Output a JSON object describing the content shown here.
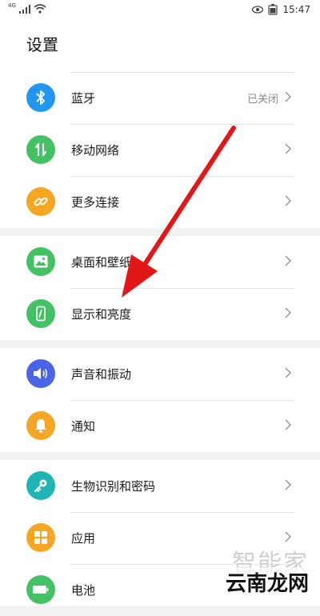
{
  "status_bar": {
    "network_label": "4G",
    "time": "15:47"
  },
  "page_title": "设置",
  "groups": [
    {
      "items": [
        {
          "label": "蓝牙",
          "value": "已关闭",
          "icon": "bluetooth-icon",
          "color": "#2196f3"
        },
        {
          "label": "移动网络",
          "icon": "mobile-data-icon",
          "color": "#43c163"
        },
        {
          "label": "更多连接",
          "icon": "link-icon",
          "color": "#f5a623"
        }
      ]
    },
    {
      "items": [
        {
          "label": "桌面和壁纸",
          "icon": "wallpaper-icon",
          "color": "#43c163"
        },
        {
          "label": "显示和亮度",
          "icon": "display-icon",
          "color": "#43c163"
        }
      ]
    },
    {
      "items": [
        {
          "label": "声音和振动",
          "icon": "sound-icon",
          "color": "#4a64e8"
        },
        {
          "label": "通知",
          "icon": "notification-bell-icon",
          "color": "#f5a623"
        }
      ]
    },
    {
      "items": [
        {
          "label": "生物识别和密码",
          "icon": "key-icon",
          "color": "#1fb5b5"
        },
        {
          "label": "应用",
          "icon": "apps-grid-icon",
          "color": "#f5a623"
        },
        {
          "label": "电池",
          "icon": "battery-icon",
          "color": "#43c163"
        }
      ]
    }
  ],
  "annotation": {
    "color": "#e21818",
    "points_to": "显示和亮度"
  },
  "watermark": {
    "top": "智能家",
    "bottom": "云南龙网"
  }
}
